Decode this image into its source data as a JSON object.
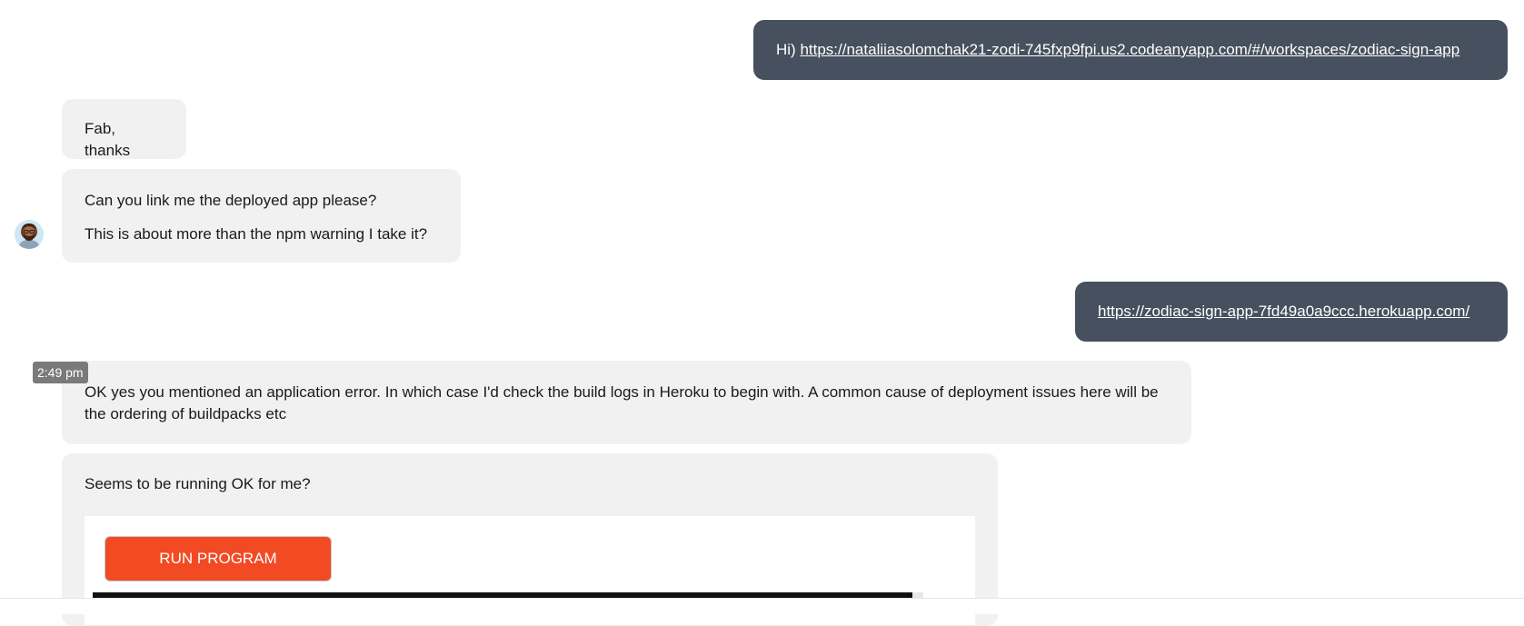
{
  "messages": {
    "m1": {
      "prefix": "Hi) ",
      "link": "https://nataliiasolomchak21-zodi-745fxp9fpi.us2.codeanyapp.com/#/workspaces/zodiac-sign-app"
    },
    "m2": {
      "text": "Fab, thanks"
    },
    "m3": {
      "line1": "Can you link me the deployed app please?",
      "line2": "This is about more than the npm warning I take it?"
    },
    "m4": {
      "link": "https://zodiac-sign-app-7fd49a0a9ccc.herokuapp.com/"
    },
    "m5": {
      "text": "OK yes you mentioned an application error. In which case I'd check the build logs in Heroku to begin with. A common cause of deployment issues here will be the ordering of buildpacks etc"
    },
    "m6": {
      "text": "Seems to be running OK for me?",
      "button_label": "RUN PROGRAM"
    }
  },
  "timestamp": "2:49 pm",
  "colors": {
    "outgoing_bubble": "#46505e",
    "incoming_bubble": "#f1f1f1",
    "run_button": "#f24a23",
    "timestamp_bg": "#7a7a7a"
  },
  "icons": {
    "avatar": "bearded-man-avatar-icon"
  }
}
